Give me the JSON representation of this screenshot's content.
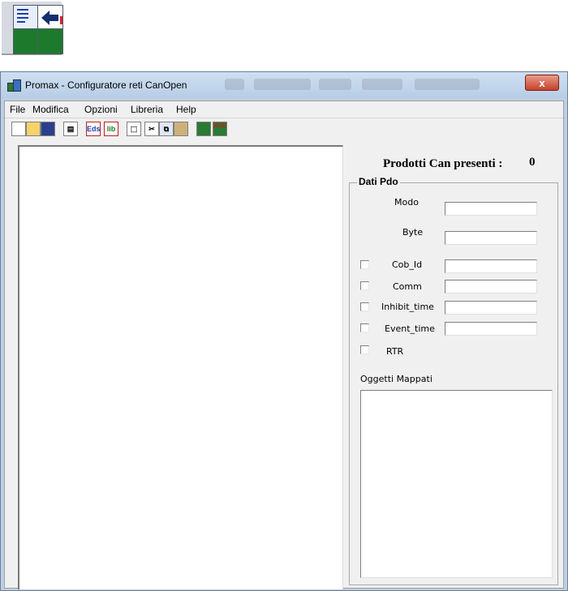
{
  "window": {
    "title": "Promax - Configuratore reti CanOpen",
    "close_label": "x"
  },
  "menu": [
    "File",
    "Modifica",
    "Opzioni",
    "Libreria",
    "Help"
  ],
  "toolbar": {
    "buttons": [
      "new-icon",
      "open-icon",
      "save-icon",
      "properties-icon",
      "add-eds-icon",
      "add-lib-icon",
      "edit-icon",
      "cut-icon",
      "copy-icon",
      "paste-icon",
      "network-icon",
      "mod-icon"
    ],
    "eds_text": "Eds",
    "lib_text": "lib",
    "mod_text": "MOD"
  },
  "products": {
    "label": "Prodotti Can presenti :",
    "count": "0"
  },
  "pdo": {
    "group_label": "Dati Pdo",
    "modo_label": "Modo",
    "byte_label": "Byte",
    "cob_id_label": "Cob_Id",
    "comm_label": "Comm",
    "inhibit_label": "Inhibit_time",
    "event_label": "Event_time",
    "rtr_label": "RTR",
    "mapped_label": "Oggetti Mappati"
  },
  "colors": {
    "titlebar": "#bfd3ea",
    "close": "#c7402a",
    "client": "#f0f0f0"
  }
}
